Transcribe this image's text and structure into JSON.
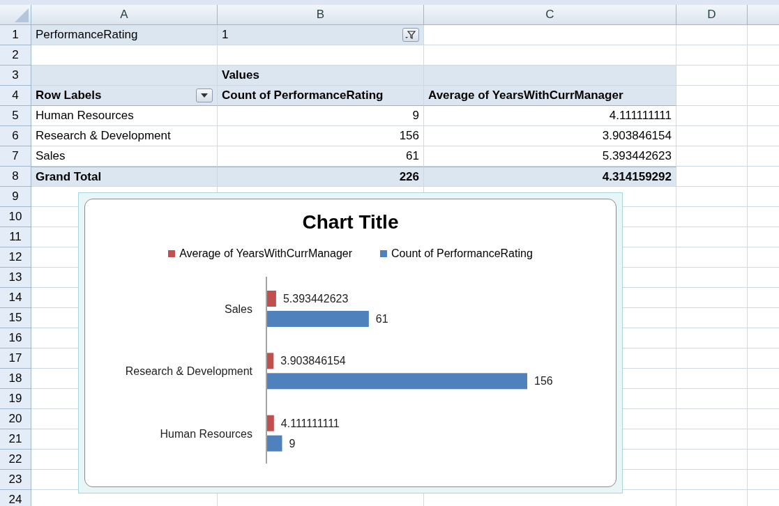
{
  "columns": [
    "A",
    "B",
    "C",
    "D"
  ],
  "rows": [
    {
      "number": "1",
      "kind": "filter",
      "label": "PerformanceRating",
      "value": "1"
    },
    {
      "number": "2",
      "kind": "empty"
    },
    {
      "number": "3",
      "kind": "caption",
      "caption": "Values"
    },
    {
      "number": "4",
      "kind": "header",
      "cells": [
        "Row Labels",
        "Count of PerformanceRating",
        "Average of YearsWithCurrManager"
      ]
    },
    {
      "number": "5",
      "kind": "data",
      "cells": [
        "Human Resources",
        "9",
        "4.111111111"
      ]
    },
    {
      "number": "6",
      "kind": "data",
      "cells": [
        "Research & Development",
        "156",
        "3.903846154"
      ]
    },
    {
      "number": "7",
      "kind": "data",
      "cells": [
        "Sales",
        "61",
        "5.393442623"
      ]
    },
    {
      "number": "8",
      "kind": "total",
      "cells": [
        "Grand Total",
        "226",
        "4.314159292"
      ]
    },
    {
      "number": "9",
      "kind": "empty"
    },
    {
      "number": "10",
      "kind": "empty"
    },
    {
      "number": "11",
      "kind": "empty"
    },
    {
      "number": "12",
      "kind": "empty"
    },
    {
      "number": "13",
      "kind": "empty"
    },
    {
      "number": "14",
      "kind": "empty"
    },
    {
      "number": "15",
      "kind": "empty"
    },
    {
      "number": "16",
      "kind": "empty"
    },
    {
      "number": "17",
      "kind": "empty"
    },
    {
      "number": "18",
      "kind": "empty"
    },
    {
      "number": "19",
      "kind": "empty"
    },
    {
      "number": "20",
      "kind": "empty"
    },
    {
      "number": "21",
      "kind": "empty"
    },
    {
      "number": "22",
      "kind": "empty"
    },
    {
      "number": "23",
      "kind": "empty"
    },
    {
      "number": "24",
      "kind": "empty"
    }
  ],
  "chart": {
    "chart_data": {
      "type": "bar",
      "orientation": "horizontal",
      "title": "Chart Title",
      "data_labels": true,
      "legend": "top",
      "categories": [
        "Sales",
        "Research & Development",
        "Human Resources"
      ],
      "series": [
        {
          "name": "Average of YearsWithCurrManager",
          "color": "#c0504d",
          "values": [
            5.393442623,
            3.903846154,
            4.111111111
          ]
        },
        {
          "name": "Count of PerformanceRating",
          "color": "#4f81bd",
          "values": [
            61,
            156,
            9
          ]
        }
      ]
    }
  }
}
